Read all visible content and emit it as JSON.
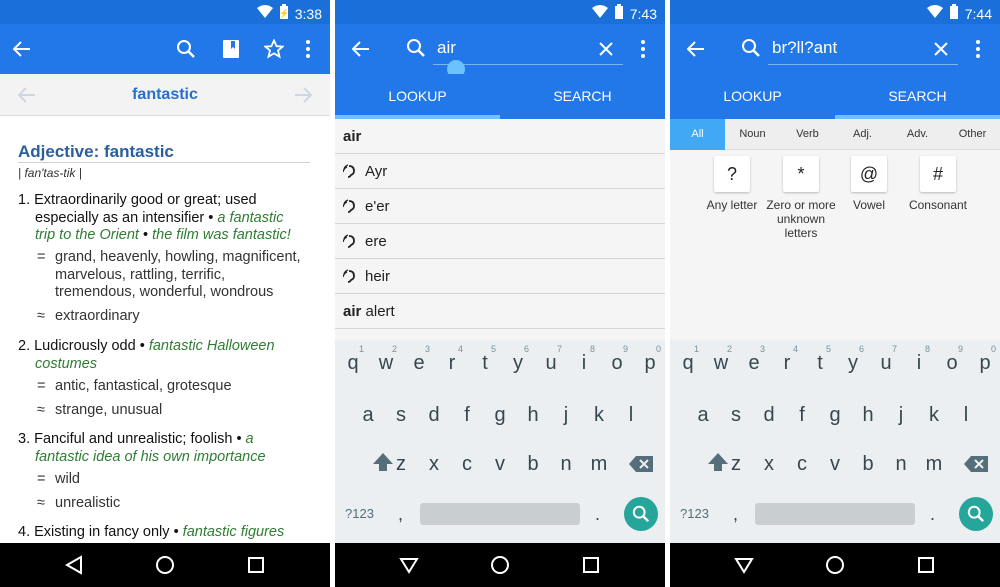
{
  "status": {
    "time1": "3:38",
    "time2": "7:43",
    "time3": "7:44"
  },
  "screen1": {
    "word": "fantastic",
    "heading": "Adjective: fantastic",
    "pron": "| fan'tas-tik |",
    "s1a": "1. Extraordinarily good or great; used",
    "s1b": "especially as an intensifier",
    "s1b_ex": "a fantastic",
    "s1c_ex": "trip to the Orient",
    "s1c_ex2": "the film was fantastic!",
    "s1_syn1a": "grand, heavenly, howling, magnificent,",
    "s1_syn1b": "marvelous, rattling, terrific,",
    "s1_syn1c": "tremendous, wonderful, wondrous",
    "s1_rel": "extraordinary",
    "s2a": "2. Ludicrously odd",
    "s2a_ex": "fantastic Halloween",
    "s2b_ex": "costumes",
    "s2_syn": "antic, fantastical, grotesque",
    "s2_rel": "strange, unusual",
    "s3a": "3. Fanciful and unrealistic; foolish",
    "s3a_ex": "a",
    "s3b_ex": "fantastic idea of his own importance",
    "s3_syn": "wild",
    "s3_rel": "unrealistic",
    "s4a": "4. Existing in fancy only",
    "s4a_ex": "fantastic figures",
    "eq": "=",
    "approx": "≈",
    "bullet": "•"
  },
  "screen2": {
    "query": "air",
    "tab_lookup": "LOOKUP",
    "tab_search": "SEARCH",
    "results": [
      {
        "text": "air",
        "bold": "air",
        "rest": "",
        "audio": false
      },
      {
        "text": "Ayr",
        "bold": "",
        "rest": "Ayr",
        "audio": true
      },
      {
        "text": "e'er",
        "bold": "",
        "rest": "e'er",
        "audio": true
      },
      {
        "text": "ere",
        "bold": "",
        "rest": "ere",
        "audio": true
      },
      {
        "text": "heir",
        "bold": "",
        "rest": "heir",
        "audio": true
      },
      {
        "text": "air alert",
        "bold": "air",
        "rest": " alert",
        "audio": false
      }
    ]
  },
  "screen3": {
    "query": "br?ll?ant",
    "tab_lookup": "LOOKUP",
    "tab_search": "SEARCH",
    "filters": [
      "All",
      "Noun",
      "Verb",
      "Adj.",
      "Adv.",
      "Other"
    ],
    "wildcards": [
      {
        "sym": "?",
        "label": "Any letter"
      },
      {
        "sym": "*",
        "label": "Zero or more unknown letters"
      },
      {
        "sym": "@",
        "label": "Vowel"
      },
      {
        "sym": "#",
        "label": "Consonant"
      }
    ]
  },
  "keyboard": {
    "row1": [
      "q",
      "w",
      "e",
      "r",
      "t",
      "y",
      "u",
      "i",
      "o",
      "p"
    ],
    "hints": [
      "1",
      "2",
      "3",
      "4",
      "5",
      "6",
      "7",
      "8",
      "9",
      "0"
    ],
    "row2": [
      "a",
      "s",
      "d",
      "f",
      "g",
      "h",
      "j",
      "k",
      "l"
    ],
    "row3": [
      "z",
      "x",
      "c",
      "v",
      "b",
      "n",
      "m"
    ],
    "sym": "?123",
    "comma": ",",
    "period": "."
  },
  "colors": {
    "appbar": "#2278e8",
    "statusbar": "#1a6fd8",
    "accent": "#6bc2ff",
    "search_fab": "#26a69a",
    "example": "#2e7d32",
    "heading": "#2a5e9c"
  }
}
